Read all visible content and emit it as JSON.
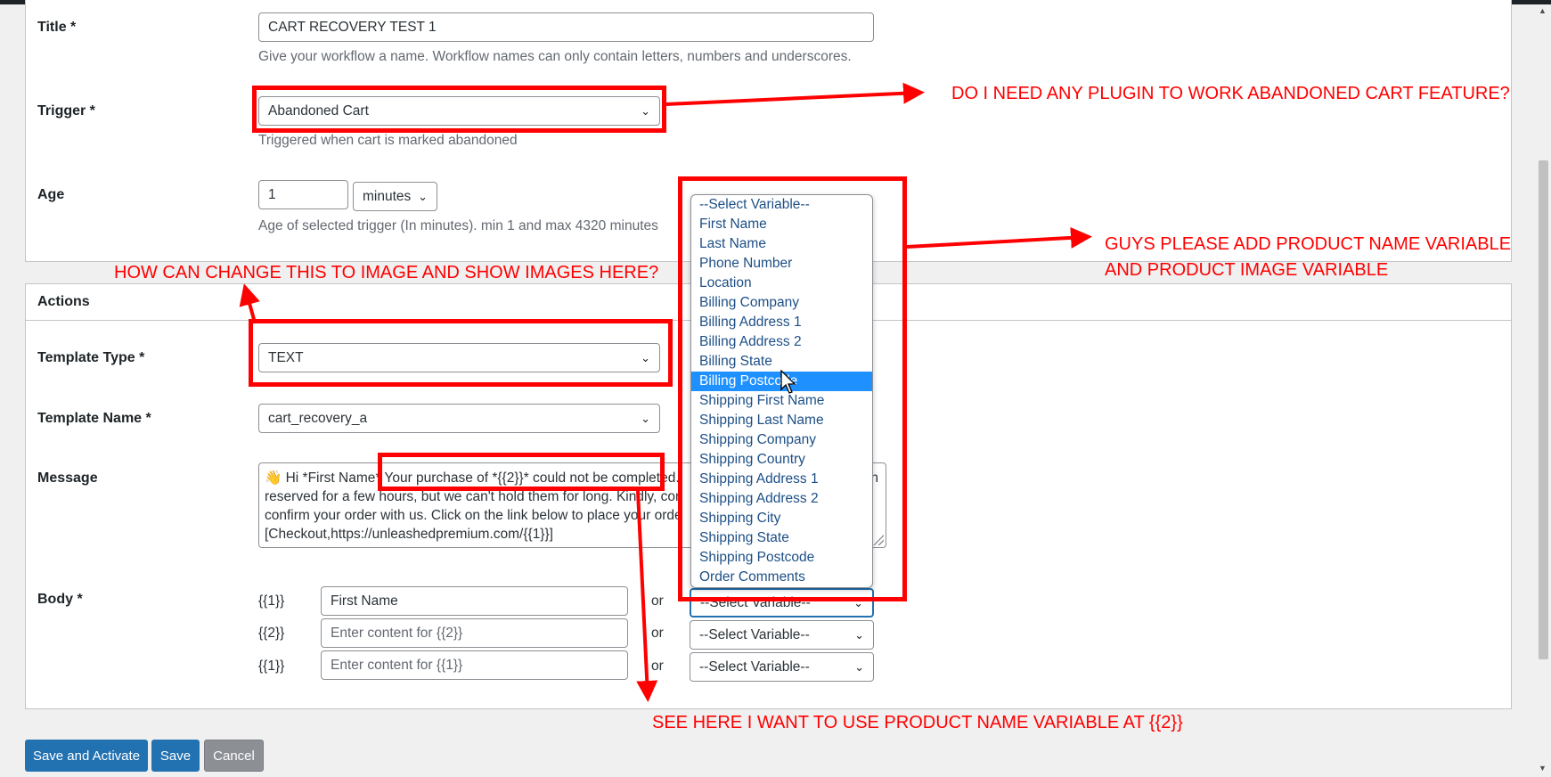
{
  "form": {
    "title": {
      "label": "Title *",
      "value": "CART RECOVERY TEST 1",
      "hint": "Give your workflow a name. Workflow names can only contain letters, numbers and underscores."
    },
    "trigger": {
      "label": "Trigger *",
      "value": "Abandoned Cart",
      "hint": "Triggered when cart is marked abandoned"
    },
    "age": {
      "label": "Age",
      "value": "1",
      "unit": "minutes",
      "hint": "Age of selected trigger (In minutes). min 1 and max 4320 minutes"
    }
  },
  "actions": {
    "heading": "Actions",
    "template_type": {
      "label": "Template Type *",
      "value": "TEXT"
    },
    "template_name": {
      "label": "Template Name *",
      "value": "cart_recovery_a"
    },
    "message": {
      "label": "Message",
      "line1": "👋 Hi *First Name* Your purchase of *{{2}}* could not be completed.",
      "line1_tail": "n",
      "line2": "reserved for a few hours, but we can't hold them for long. Kindly, con",
      "line3": "confirm your order with us. Click on the link below to place your orde",
      "line4": "[Checkout,https://unleashedpremium.com/{{1}}]"
    },
    "body": {
      "label": "Body *",
      "or": "or",
      "rows": [
        {
          "var": "{{1}}",
          "value": "First Name",
          "placeholder": "",
          "select": "--Select Variable--"
        },
        {
          "var": "{{2}}",
          "value": "",
          "placeholder": "Enter content for {{2}}",
          "select": "--Select Variable--"
        },
        {
          "var": "{{1}}",
          "value": "",
          "placeholder": "Enter content for {{1}}",
          "select": "--Select Variable--"
        }
      ]
    }
  },
  "dropdown": {
    "options": [
      "--Select Variable--",
      "First Name",
      "Last Name",
      "Phone Number",
      "Location",
      "Billing Company",
      "Billing Address 1",
      "Billing Address 2",
      "Billing State",
      "Billing Postcode",
      "Shipping First Name",
      "Shipping Last Name",
      "Shipping Company",
      "Shipping Country",
      "Shipping Address 1",
      "Shipping Address 2",
      "Shipping City",
      "Shipping State",
      "Shipping Postcode",
      "Order Comments"
    ],
    "selected_index": 9
  },
  "buttons": {
    "save_activate": "Save and Activate",
    "save": "Save",
    "cancel": "Cancel"
  },
  "annotations": {
    "plugin_question": "DO I NEED ANY PLUGIN TO WORK ABANDONED CART FEATURE?",
    "add_variable_line1": "GUYS PLEASE ADD PRODUCT NAME VARIABLE",
    "add_variable_line2": "AND PRODUCT IMAGE VARIABLE",
    "image_question": "HOW CAN CHANGE THIS TO IMAGE AND SHOW IMAGES HERE?",
    "product_name_note": "SEE HERE I WANT TO USE PRODUCT NAME VARIABLE AT {{2}}"
  },
  "colors": {
    "annotation": "#ff0000",
    "primary": "#2271b1",
    "selected": "#1e90ff"
  },
  "icons": {
    "chevron": "chevron-down-icon",
    "cursor": "mouse-pointer-icon"
  }
}
